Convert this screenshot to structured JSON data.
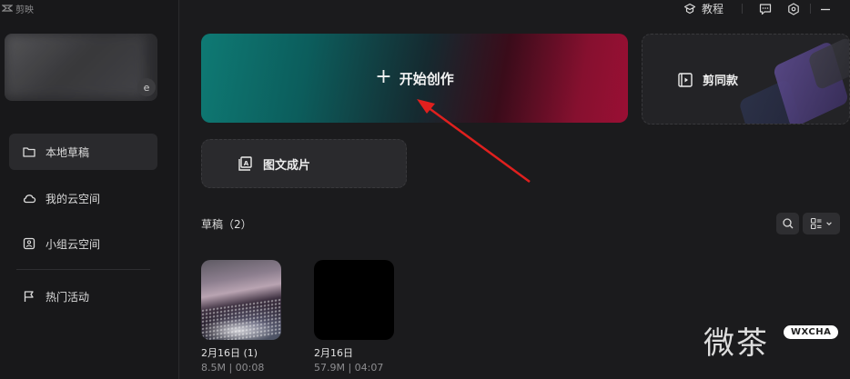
{
  "app": {
    "name": "剪映"
  },
  "topbar": {
    "tutorial_label": "教程",
    "icons": [
      "tutorial-icon",
      "feedback-icon",
      "settings-icon",
      "minimize-icon"
    ]
  },
  "sidebar": {
    "profile_badge": "e",
    "items": [
      {
        "label": "本地草稿",
        "icon": "folder-icon",
        "active": true
      },
      {
        "label": "我的云空间",
        "icon": "cloud-icon",
        "active": false
      },
      {
        "label": "小组云空间",
        "icon": "team-cloud-icon",
        "active": false
      },
      {
        "label": "热门活动",
        "icon": "flag-icon",
        "active": false
      }
    ]
  },
  "main": {
    "start_label": "开始创作",
    "template_label": "剪同款",
    "image_text_label": "图文成片",
    "drafts_title": "草稿（2）",
    "drafts": [
      {
        "name": "2月16日 (1)",
        "meta": "8.5M | 00:08"
      },
      {
        "name": "2月16日",
        "meta": "57.9M | 04:07"
      }
    ]
  },
  "watermark": {
    "text": "微茶",
    "badge": "WXCHA"
  },
  "colors": {
    "accent_teal": "#0e7a74",
    "accent_red": "#9a0f34",
    "arrow": "#e0201e"
  }
}
